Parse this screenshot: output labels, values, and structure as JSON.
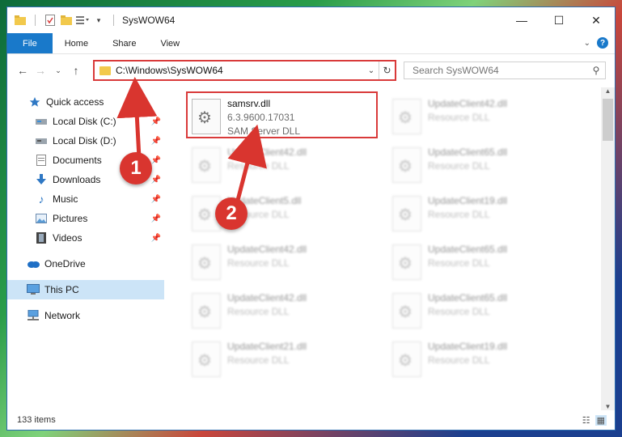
{
  "window": {
    "title": "SysWOW64",
    "controls": {
      "minimize": "—",
      "maximize": "☐",
      "close": "✕"
    }
  },
  "ribbon": {
    "tabs": [
      "File",
      "Home",
      "Share",
      "View"
    ],
    "help": "?"
  },
  "address": {
    "path": "C:\\Windows\\SysWOW64",
    "search_placeholder": "Search SysWOW64"
  },
  "sidebar": {
    "items": [
      {
        "label": "Quick access",
        "icon": "star-icon"
      },
      {
        "label": "Local Disk (C:)",
        "icon": "drive-icon",
        "pinned": true
      },
      {
        "label": "Local Disk (D:)",
        "icon": "drive-icon",
        "pinned": true
      },
      {
        "label": "Documents",
        "icon": "documents-icon",
        "pinned": true
      },
      {
        "label": "Downloads",
        "icon": "download-icon",
        "pinned": true
      },
      {
        "label": "Music",
        "icon": "music-icon",
        "pinned": true
      },
      {
        "label": "Pictures",
        "icon": "pictures-icon",
        "pinned": true
      },
      {
        "label": "Videos",
        "icon": "videos-icon",
        "pinned": true
      },
      {
        "label": "OneDrive",
        "icon": "cloud-icon"
      },
      {
        "label": "This PC",
        "icon": "computer-icon",
        "selected": true
      },
      {
        "label": "Network",
        "icon": "network-icon"
      }
    ]
  },
  "files": [
    {
      "name": "samsrv.dll",
      "version": "6.3.9600.17031",
      "desc": "SAM Server DLL"
    },
    {
      "name": "UpdateClient42.dll",
      "desc": "Resource DLL"
    },
    {
      "name": "UpdateClient42.dll",
      "desc": "Resource DLL"
    },
    {
      "name": "UpdateClient65.dll",
      "desc": "Resource DLL"
    },
    {
      "name": "UpdateClient5.dll",
      "desc": "Resource DLL"
    },
    {
      "name": "UpdateClient19.dll",
      "desc": "Resource DLL"
    },
    {
      "name": "UpdateClient42.dll",
      "desc": "Resource DLL"
    },
    {
      "name": "UpdateClient65.dll",
      "desc": "Resource DLL"
    },
    {
      "name": "UpdateClient42.dll",
      "desc": "Resource DLL"
    },
    {
      "name": "UpdateClient65.dll",
      "desc": "Resource DLL"
    },
    {
      "name": "UpdateClient21.dll",
      "desc": "Resource DLL"
    },
    {
      "name": "UpdateClient19.dll",
      "desc": "Resource DLL"
    }
  ],
  "status": {
    "count": "133 items"
  },
  "annotations": [
    "1",
    "2"
  ]
}
